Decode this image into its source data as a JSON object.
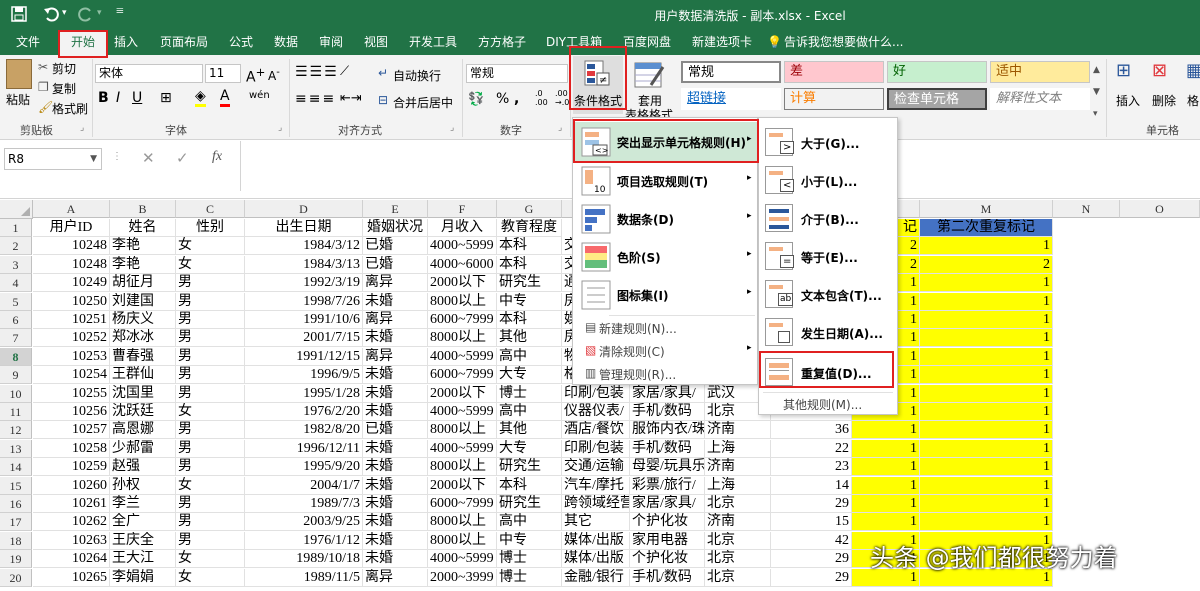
{
  "titlebar": {
    "title": "用户数据清洗版 - 副本.xlsx - Excel"
  },
  "tabs": [
    "文件",
    "开始",
    "插入",
    "页面布局",
    "公式",
    "数据",
    "审阅",
    "视图",
    "开发工具",
    "方方格子",
    "DIY工具箱",
    "百度网盘",
    "新建选项卡"
  ],
  "tellme": "告诉我您想要做什么...",
  "ribbon": {
    "paste": "粘贴",
    "cut": "剪切",
    "copy": "复制",
    "format_painter": "格式刷",
    "clipboard": "剪贴板",
    "font_name": "宋体",
    "font_size": "11",
    "font": "字体",
    "wrap_text": "自动换行",
    "merge_center": "合并后居中",
    "alignment": "对齐方式",
    "number_format": "常规",
    "number": "数字",
    "cond_format": "条件格式",
    "table_format_1": "套用",
    "table_format_2": "表格格式",
    "styles": {
      "normal": "常规",
      "bad": "差",
      "good": "好",
      "neutral": "适中",
      "hyperlink": "超链接",
      "calc": "计算",
      "check": "检查单元格",
      "explain": "解释性文本"
    },
    "insert": "插入",
    "delete": "删除",
    "format": "格",
    "cells": "单元格"
  },
  "formula_bar": {
    "name_box": "R8",
    "fx": "fx"
  },
  "columns": [
    "A",
    "B",
    "C",
    "D",
    "E",
    "F",
    "G",
    "H",
    "I",
    "J",
    "K",
    "L",
    "M",
    "N",
    "O"
  ],
  "header_row": [
    "用户ID",
    "姓名",
    "性别",
    "出生日期",
    "婚姻状况",
    "月收入",
    "教育程度",
    "",
    "",
    "",
    "",
    "记",
    "第二次重复标记"
  ],
  "rows": [
    [
      "10248",
      "李艳",
      "女",
      "1984/3/12",
      "已婚",
      "4000~5999",
      "本科",
      "交",
      "",
      "",
      "",
      "2",
      "1"
    ],
    [
      "10248",
      "李艳",
      "女",
      "1984/3/13",
      "已婚",
      "4000~6000",
      "本科",
      "交",
      "",
      "",
      "",
      "2",
      "2"
    ],
    [
      "10249",
      "胡征月",
      "男",
      "1992/3/19",
      "离异",
      "2000以下",
      "研究生",
      "通",
      "",
      "",
      "",
      "1",
      "1"
    ],
    [
      "10250",
      "刘建国",
      "男",
      "1998/7/26",
      "未婚",
      "8000以上",
      "中专",
      "房",
      "",
      "",
      "",
      "1",
      "1"
    ],
    [
      "10251",
      "杨庆义",
      "男",
      "1991/10/6",
      "离异",
      "6000~7999",
      "本科",
      "娱",
      "",
      "",
      "",
      "1",
      "1"
    ],
    [
      "10252",
      "郑冰冰",
      "男",
      "2001/7/15",
      "未婚",
      "8000以上",
      "其他",
      "房",
      "",
      "",
      "",
      "1",
      "1"
    ],
    [
      "10253",
      "曹春强",
      "男",
      "1991/12/15",
      "离异",
      "4000~5999",
      "高中",
      "物",
      "",
      "",
      "",
      "1",
      "1"
    ],
    [
      "10254",
      "王群仙",
      "男",
      "1996/9/5",
      "未婚",
      "6000~7999",
      "大专",
      "格",
      "",
      "",
      "",
      "1",
      "1"
    ],
    [
      "10255",
      "沈国里",
      "男",
      "1995/1/28",
      "未婚",
      "2000以下",
      "博士",
      "印刷/包装",
      "家居/家具/",
      "武汉",
      "",
      "1",
      "1"
    ],
    [
      "10256",
      "沈跃廷",
      "女",
      "1976/2/20",
      "未婚",
      "4000~5999",
      "高中",
      "仪器仪表/",
      "手机/数码",
      "北京",
      "12",
      "1",
      "1"
    ],
    [
      "10257",
      "高恩娜",
      "男",
      "1982/8/20",
      "已婚",
      "8000以上",
      "其他",
      "酒店/餐饮",
      "服饰内衣/珠",
      "济南",
      "36",
      "1",
      "1"
    ],
    [
      "10258",
      "少郝雷",
      "男",
      "1996/12/11",
      "未婚",
      "4000~5999",
      "大专",
      "印刷/包装",
      "手机/数码",
      "上海",
      "22",
      "1",
      "1"
    ],
    [
      "10259",
      "赵强",
      "男",
      "1995/9/20",
      "未婚",
      "8000以上",
      "研究生",
      "交通/运输",
      "母婴/玩具乐",
      "济南",
      "23",
      "1",
      "1"
    ],
    [
      "10260",
      "孙权",
      "女",
      "2004/1/7",
      "未婚",
      "2000以下",
      "本科",
      "汽车/摩托",
      "彩票/旅行/",
      "上海",
      "14",
      "1",
      "1"
    ],
    [
      "10261",
      "李兰",
      "男",
      "1989/7/3",
      "未婚",
      "6000~7999",
      "研究生",
      "跨领域经营",
      "家居/家具/",
      "北京",
      "29",
      "1",
      "1"
    ],
    [
      "10262",
      "全广",
      "男",
      "2003/9/25",
      "未婚",
      "8000以上",
      "高中",
      "其它",
      "个护化妆",
      "济南",
      "15",
      "1",
      "1"
    ],
    [
      "10263",
      "王庆全",
      "男",
      "1976/1/12",
      "未婚",
      "8000以上",
      "中专",
      "媒体/出版",
      "家用电器",
      "北京",
      "42",
      "1",
      "1"
    ],
    [
      "10264",
      "王大江",
      "女",
      "1989/10/18",
      "未婚",
      "4000~5999",
      "博士",
      "媒体/出版",
      "个护化妆",
      "北京",
      "29",
      "1",
      "1"
    ],
    [
      "10265",
      "李娟娟",
      "女",
      "1989/11/5",
      "离异",
      "2000~3999",
      "博士",
      "金融/银行",
      "手机/数码",
      "北京",
      "29",
      "1",
      "1"
    ]
  ],
  "menu1": {
    "highlight": "突出显示单元格规则(H)",
    "topbottom": "项目选取规则(T)",
    "databar": "数据条(D)",
    "colorscale": "色阶(S)",
    "iconset": "图标集(I)",
    "new_rule": "新建规则(N)...",
    "clear_rule": "清除规则(C)",
    "manage_rule": "管理规则(R)..."
  },
  "menu2": {
    "greater": "大于(G)...",
    "less": "小于(L)...",
    "between": "介于(B)...",
    "equal": "等于(E)...",
    "text": "文本包含(T)...",
    "date": "发生日期(A)...",
    "duplicate": "重复值(D)...",
    "more": "其他规则(M)..."
  },
  "watermark": "头条 @我们都很努力着",
  "colors": {
    "excel_green": "#217346",
    "highlight": "#cfe8d6",
    "header_fill": "#4472c4",
    "mark_fill": "#ffff00",
    "annotation": "#e02020"
  }
}
